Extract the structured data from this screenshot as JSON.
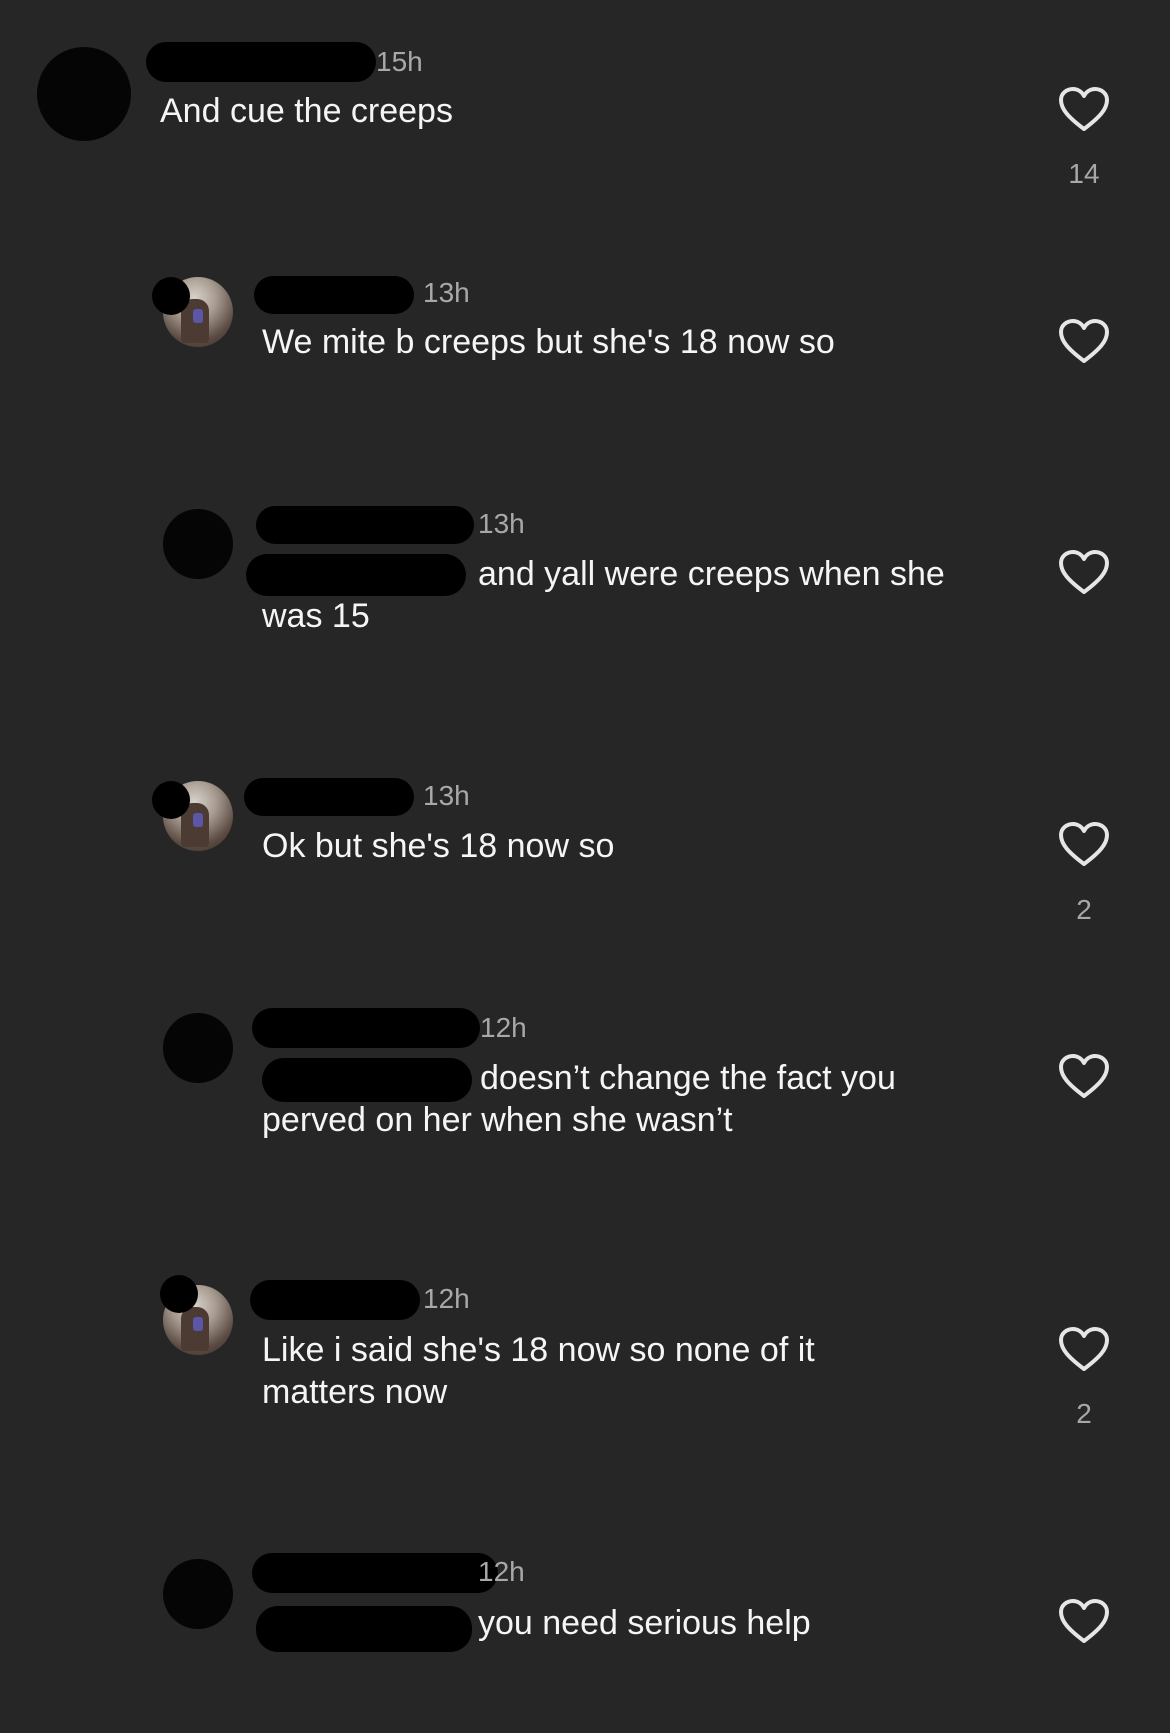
{
  "comments": [
    {
      "time": "15h",
      "text_lines": [
        "And cue the creeps"
      ],
      "likes": "14"
    },
    {
      "time": "13h",
      "text_lines": [
        "We mite b creeps but she's 18 now so"
      ],
      "likes": ""
    },
    {
      "time": "13h",
      "text_lines": [
        "and yall were creeps when she",
        "was 15"
      ],
      "likes": ""
    },
    {
      "time": "13h",
      "text_lines": [
        "Ok but she's 18 now so"
      ],
      "likes": "2"
    },
    {
      "time": "12h",
      "text_lines": [
        "doesn’t change the fact you",
        "perved on her when she wasn’t"
      ],
      "likes": ""
    },
    {
      "time": "12h",
      "text_lines": [
        "Like i said she's 18 now so none of it",
        "matters now"
      ],
      "likes": "2"
    },
    {
      "time": "12h",
      "text_lines": [
        "you need serious help"
      ],
      "likes": ""
    }
  ],
  "icons": {
    "like": "heart-outline-icon"
  },
  "colors": {
    "background": "#262626",
    "text": "#f5f5f5",
    "meta": "#a8a8a8"
  }
}
